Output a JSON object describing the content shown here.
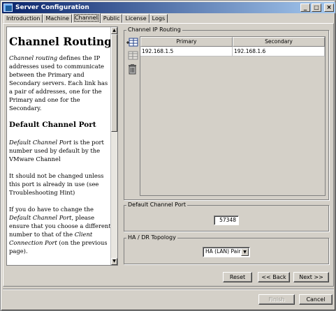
{
  "window": {
    "title": "Server Configuration",
    "controls": {
      "minimize": "_",
      "maximize": "□",
      "close": "×"
    }
  },
  "tabs": [
    {
      "label": "Introduction",
      "active": false
    },
    {
      "label": "Machine",
      "active": false
    },
    {
      "label": "Channel",
      "active": true
    },
    {
      "label": "Public",
      "active": false
    },
    {
      "label": "License",
      "active": false
    },
    {
      "label": "Logs",
      "active": false
    }
  ],
  "help": {
    "heading": "Channel Routing",
    "intro_term": "Channel routing",
    "intro_text": " defines the IP addresses used to communicate between the Primary and Secondary servers. Each link has a pair of addresses, one for the Primary and one for the Secondary.",
    "subheading": "Default Channel Port",
    "p1_term": "Default Channel Port",
    "p1_text": " is the port number used by default by the VMware Channel",
    "p2": "It should not be changed unless this port is already in use (see Troubleshooting Hint)",
    "p3_a": "If you do have to change the ",
    "p3_term1": "Default Channel Port",
    "p3_b": ", please ensure that you choose a different number to that of the ",
    "p3_term2": "Client Connection Port",
    "p3_c": " (on the previous page)."
  },
  "routing": {
    "group_label": "Channel IP Routing",
    "columns": [
      "Primary",
      "Secondary"
    ],
    "rows": [
      {
        "primary": "192.168.1.5",
        "secondary": "192.168.1.6"
      }
    ],
    "icons": [
      "add-route-icon",
      "edit-route-icon",
      "delete-route-icon"
    ]
  },
  "port": {
    "group_label": "Default Channel Port",
    "value": "57348"
  },
  "topology": {
    "group_label": "HA / DR Topology",
    "selected": "HA (LAN) Pair"
  },
  "nav": {
    "reset": "Reset",
    "back": "<< Back",
    "next": "Next >>"
  },
  "footer": {
    "finish": "Finish",
    "cancel": "Cancel"
  },
  "colors": {
    "title_gradient_start": "#0a246a",
    "title_gradient_end": "#a6caf0",
    "face": "#d4d0c8"
  }
}
